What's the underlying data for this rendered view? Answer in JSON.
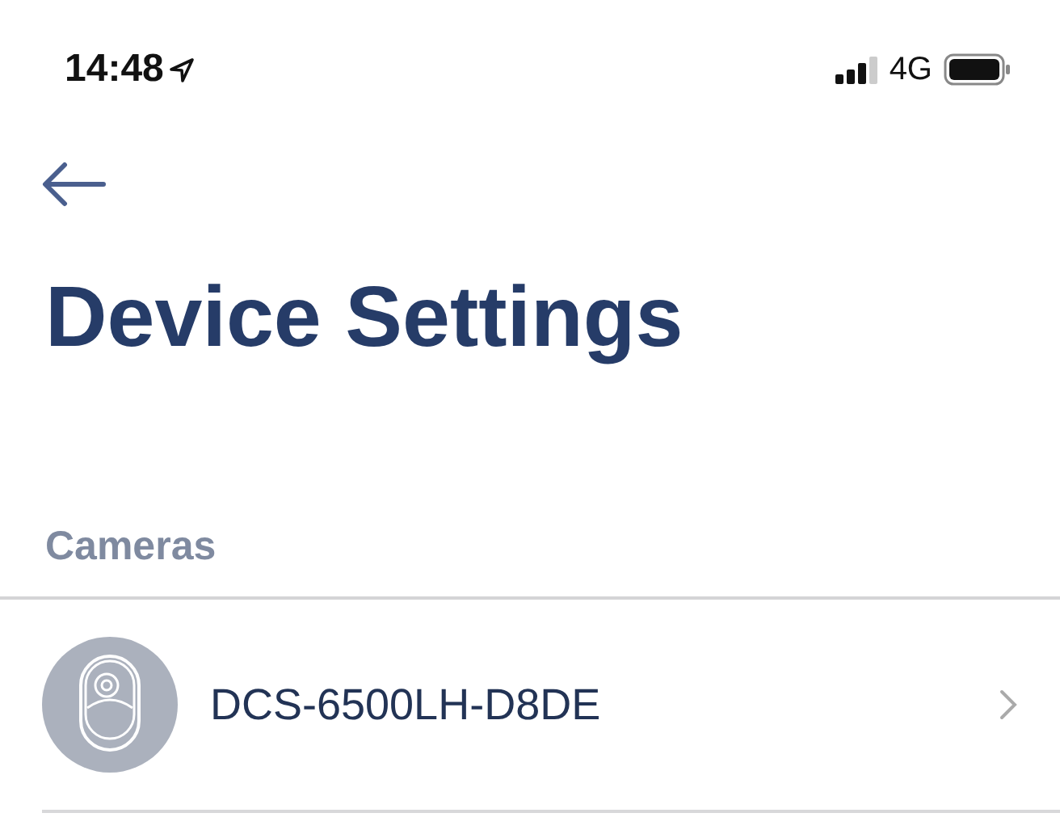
{
  "status_bar": {
    "time": "14:48",
    "network": "4G"
  },
  "title": "Device Settings",
  "sections": [
    {
      "label": "Cameras",
      "devices": [
        {
          "name": "DCS-6500LH-D8DE"
        }
      ]
    }
  ]
}
